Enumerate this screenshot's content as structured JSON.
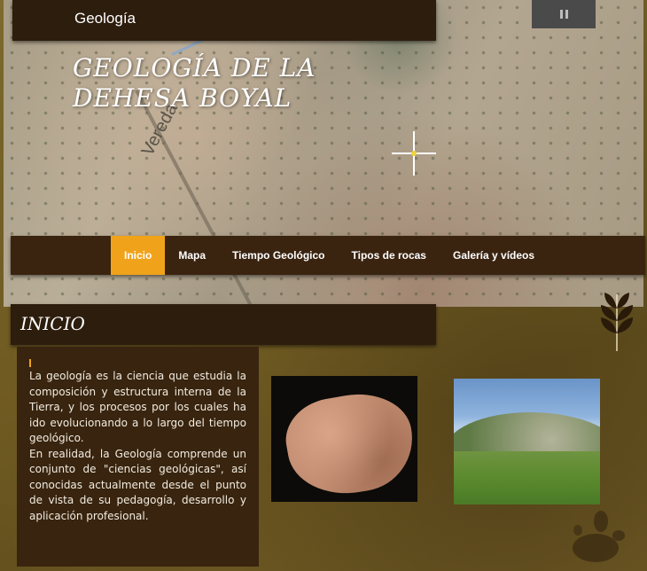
{
  "header": {
    "section_label": "Geología",
    "site_title": "GEOLOGÍA DE LA DEHESA BOYAL",
    "map_road_label": "Vereda"
  },
  "slideshow": {
    "control": "pause-icon"
  },
  "nav": {
    "items": [
      {
        "label": "Inicio",
        "active": true
      },
      {
        "label": "Mapa",
        "active": false
      },
      {
        "label": "Tiempo Geológico",
        "active": false
      },
      {
        "label": "Tipos de rocas",
        "active": false
      },
      {
        "label": "Galería y vídeos",
        "active": false
      }
    ]
  },
  "section": {
    "heading": "INICIO",
    "paragraph1": "La geología es la ciencia que estudia la composición y estructura interna de la Tierra, y los procesos por los cuales ha ido evolucionando a lo largo del tiempo geológico.",
    "paragraph2": "En realidad, la Geología comprende un conjunto de \"ciencias geológicas\", así conocidas actualmente desde el punto de vista de su pedagogía, desarrollo y aplicación profesional."
  },
  "colors": {
    "accent": "#f0a31a",
    "bar_dark": "#2d1d0d",
    "nav_bg": "#3a2410",
    "text_panel_bg": "#38240f"
  }
}
